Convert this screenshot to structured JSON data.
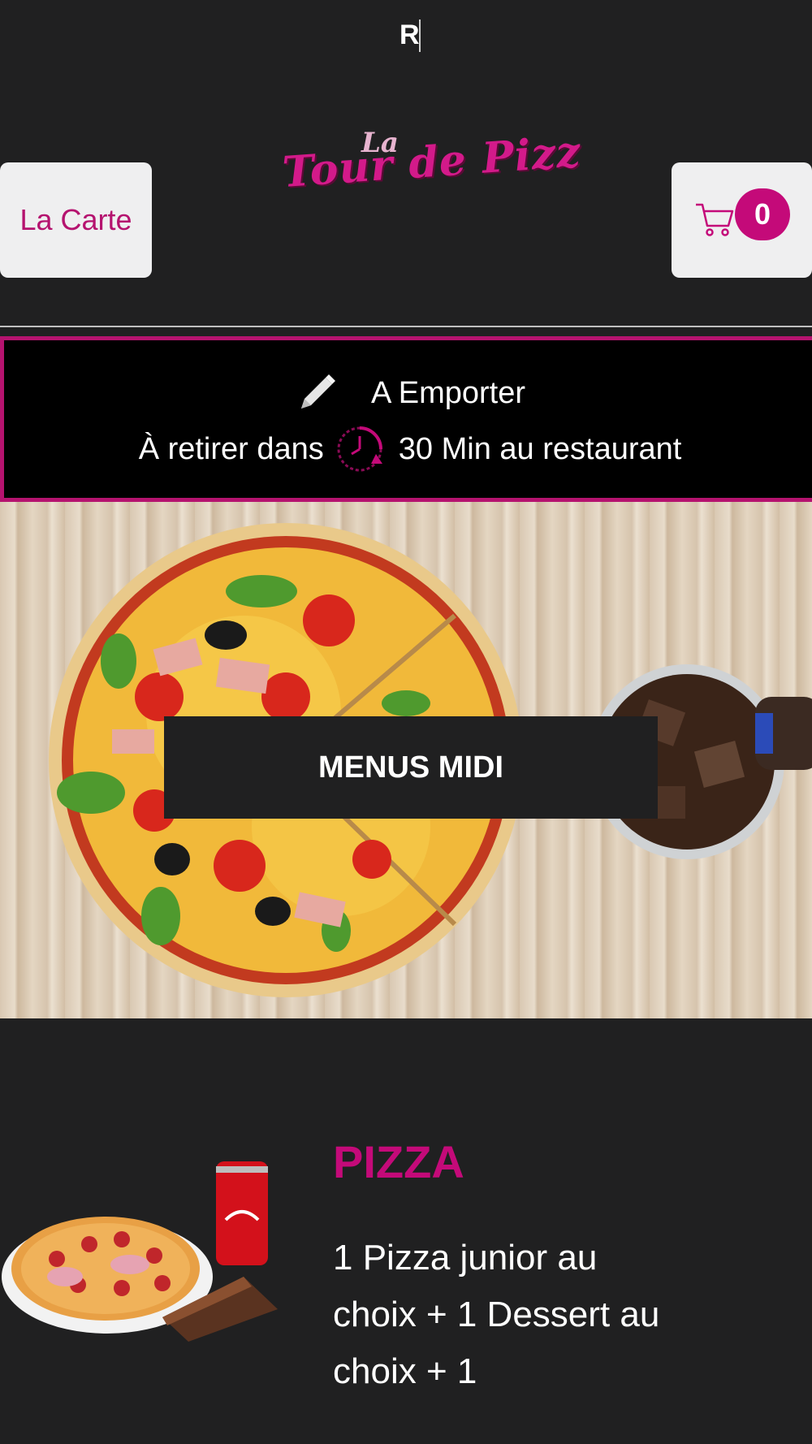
{
  "topbar": {
    "letter": "R"
  },
  "header": {
    "carte_label": "La Carte",
    "logo_small": "La",
    "logo_main": "Tour de Pizz",
    "cart_count": "0"
  },
  "notice": {
    "mode": "A Emporter",
    "pickup_prefix": "À retirer dans",
    "pickup_suffix": "30 Min au restaurant"
  },
  "hero": {
    "button_label": "MENUS MIDI"
  },
  "product": {
    "title": "PIZZA",
    "description": "1 Pizza junior au choix + 1 Dessert au choix + 1"
  },
  "colors": {
    "accent": "#c40a79",
    "background": "#202021",
    "button_bg": "#efeff0"
  },
  "icons": [
    "pencil-icon",
    "clock-icon",
    "cart-icon"
  ]
}
